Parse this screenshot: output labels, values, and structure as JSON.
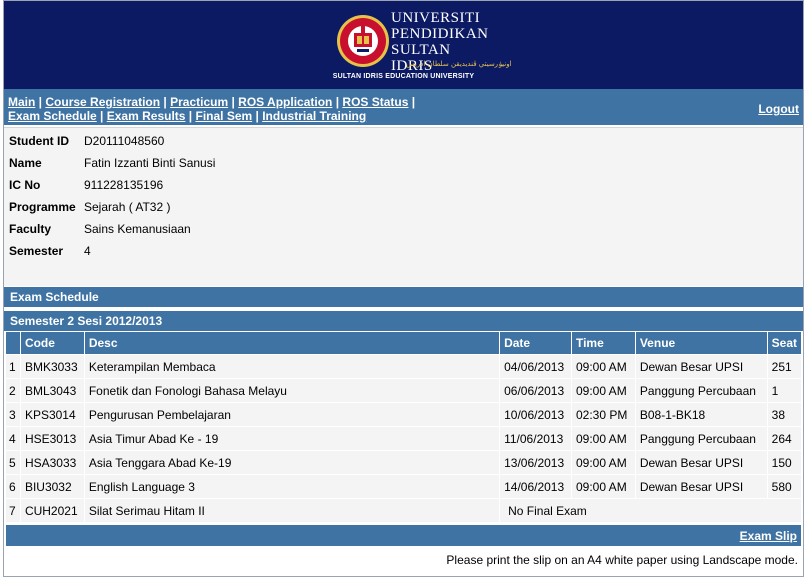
{
  "header": {
    "uni_line1": "UNIVERSITI",
    "uni_line2": "PENDIDIKAN",
    "uni_line3": "SULTAN IDRIS",
    "jawi": "اونيۏرسيتي ڤنديديقن سلطان ادريس",
    "tagline": "SULTAN IDRIS EDUCATION UNIVERSITY",
    "colors": {
      "banner": "#0c1a63",
      "bar": "#3f73a3",
      "seal_red": "#c8102e",
      "seal_gold": "#e6c24a"
    }
  },
  "nav": {
    "row1": [
      "Main",
      "Course Registration",
      "Practicum",
      "ROS Application",
      "ROS Status"
    ],
    "row2": [
      "Exam Schedule",
      "Exam Results",
      "Final Sem",
      "Industrial Training"
    ],
    "logout": "Logout"
  },
  "student": [
    {
      "label": "Student ID",
      "value": "D20111048560"
    },
    {
      "label": "Name",
      "value": "Fatin Izzanti Binti Sanusi"
    },
    {
      "label": "IC No",
      "value": "911228135196"
    },
    {
      "label": "Programme",
      "value": "Sejarah ( AT32 )"
    },
    {
      "label": "Faculty",
      "value": "Sains Kemanusiaan"
    },
    {
      "label": "Semester",
      "value": "4"
    }
  ],
  "exam": {
    "section_title": "Exam Schedule",
    "semester_title": "Semester 2 Sesi 2012/2013",
    "columns": [
      "",
      "Code",
      "Desc",
      "Date",
      "Time",
      "Venue",
      "Seat"
    ],
    "rows": [
      {
        "no": "1",
        "code": "BMK3033",
        "desc": "Keterampilan Membaca",
        "date": "04/06/2013",
        "time": "09:00 AM",
        "venue": "Dewan Besar UPSI",
        "seat": "251"
      },
      {
        "no": "2",
        "code": "BML3043",
        "desc": "Fonetik dan Fonologi Bahasa Melayu",
        "date": "06/06/2013",
        "time": "09:00 AM",
        "venue": "Panggung Percubaan",
        "seat": "1"
      },
      {
        "no": "3",
        "code": "KPS3014",
        "desc": "Pengurusan Pembelajaran",
        "date": "10/06/2013",
        "time": "02:30 PM",
        "venue": "B08-1-BK18",
        "seat": "38"
      },
      {
        "no": "4",
        "code": "HSE3013",
        "desc": "Asia Timur Abad Ke - 19",
        "date": "11/06/2013",
        "time": "09:00 AM",
        "venue": "Panggung Percubaan",
        "seat": "264"
      },
      {
        "no": "5",
        "code": "HSA3033",
        "desc": "Asia Tenggara Abad Ke-19",
        "date": "13/06/2013",
        "time": "09:00 AM",
        "venue": "Dewan Besar UPSI",
        "seat": "150"
      },
      {
        "no": "6",
        "code": "BIU3032",
        "desc": "English Language 3",
        "date": "14/06/2013",
        "time": "09:00 AM",
        "venue": "Dewan Besar UPSI",
        "seat": "580"
      }
    ],
    "last_row": {
      "no": "7",
      "code": "CUH2021",
      "desc": "Silat Serimau Hitam II",
      "note": "No Final Exam"
    },
    "slip_link": "Exam Slip",
    "print_note": "Please print the slip on an A4 white paper using Landscape mode."
  }
}
